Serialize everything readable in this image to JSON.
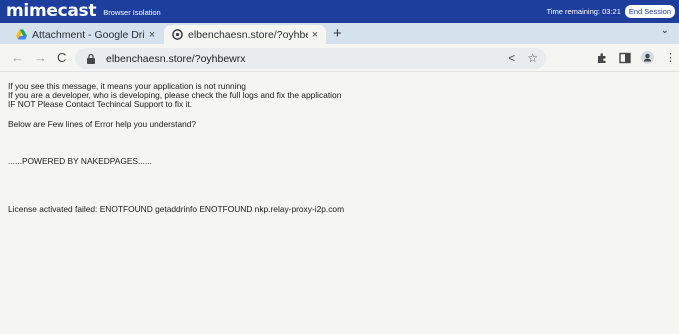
{
  "mimecast": {
    "logo": "mimecast",
    "product": "Browser Isolation",
    "time_remaining": "Time remaining: 03:21",
    "end_session": "End Session"
  },
  "tabs": [
    {
      "label": "Attachment - Google Drive",
      "close": "×"
    },
    {
      "label": "elbenchaesn.store/?oyhbewrx",
      "close": "×"
    }
  ],
  "new_tab": "+",
  "tab_menu": "⌄",
  "address_bar": {
    "url": "elbenchaesn.store/?oyhbewrx"
  },
  "page": {
    "lines": [
      "If you see this message, it means your application is not running",
      "If you are a developer, who  is developing, please check the full logs and fix the application",
      "IF NOT Please Contact Techincal Support to fix it.",
      "Below are Few lines of Error help you understand?",
      "......POWERED BY NAKEDPAGES......",
      "License activated failed: ENOTFOUND getaddrinfo ENOTFOUND nkp.relay-proxy-i2p.com"
    ]
  }
}
